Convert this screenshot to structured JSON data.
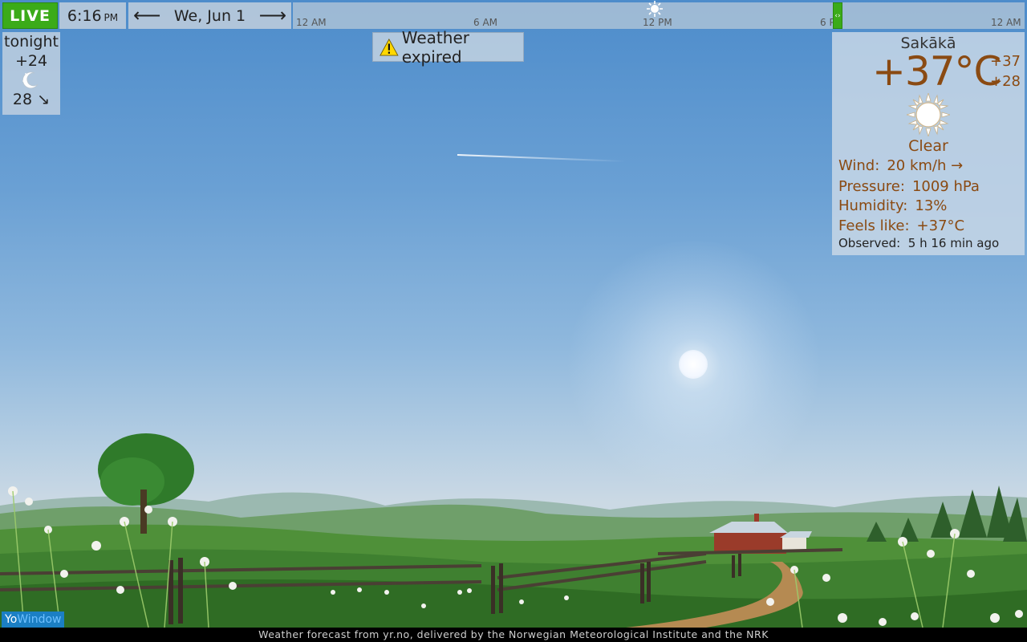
{
  "topbar": {
    "live_label": "LIVE",
    "time": "6:16",
    "ampm": "PM",
    "date": "We, Jun 1",
    "prev_arrow": "⟵",
    "next_arrow": "⟶",
    "timeline_labels": [
      "12 AM",
      "6 AM",
      "12 PM",
      "6 P",
      "12 AM"
    ],
    "slider_glyph": "‹›"
  },
  "tonight": {
    "title": "tonight",
    "temp": "+24",
    "icon": "moon-icon",
    "wind": "28 ↘"
  },
  "alert": {
    "icon": "warning-icon",
    "text": "Weather expired"
  },
  "current": {
    "location": "Sakākā",
    "temperature": "+37°C",
    "high": "+37",
    "low": "+28",
    "icon": "sun-icon",
    "condition": "Clear",
    "wind_label": "Wind:",
    "wind_value": "20 km/h →",
    "pressure_label": "Pressure:",
    "pressure_value": "1009 hPa",
    "humidity_label": "Humidity:",
    "humidity_value": "13%",
    "feels_label": "Feels like:",
    "feels_value": "+37°C",
    "observed_label": "Observed:",
    "observed_value": "5 h 16 min ago"
  },
  "brand": {
    "logo_a": "Yo",
    "logo_b": "Window"
  },
  "footer": {
    "text": "Weather forecast from yr.no, delivered by the Norwegian Meteorological Institute and the NRK"
  },
  "colors": {
    "live_green": "#3bab19",
    "temp_brown": "#8a4a12",
    "sky_top": "#4d8ccb"
  }
}
